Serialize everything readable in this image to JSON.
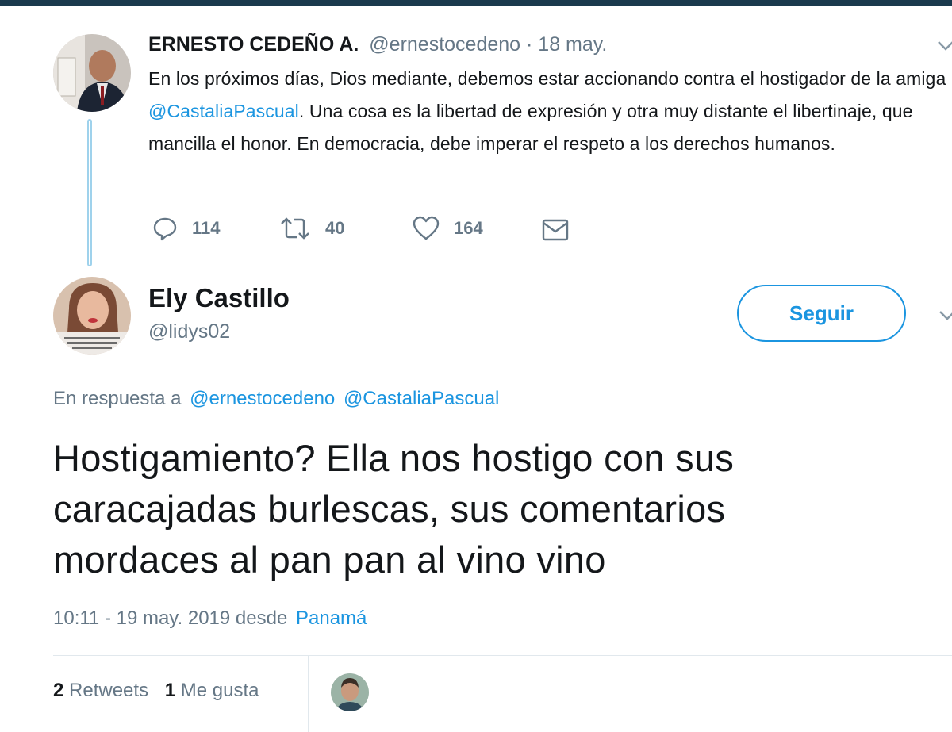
{
  "tweet1": {
    "author_name": "ERNESTO CEDEÑO A.",
    "handle": "@ernestocedeno",
    "date": "· 18 may.",
    "text_before": "En los próximos días, Dios mediante, debemos estar accionando contra el hostigador de la amiga ",
    "mention": "@CastaliaPascual",
    "text_after": ". Una cosa es la libertad de expresión y otra muy distante el libertinaje, que mancilla el honor. En democracia, debe imperar el respeto a los derechos humanos.",
    "replies": "114",
    "retweets": "40",
    "likes": "164"
  },
  "tweet2": {
    "author_name": "Ely Castillo",
    "handle": "@lidys02",
    "follow_label": "Seguir",
    "reply_prefix": "En respuesta a",
    "reply_mention_1": "@ernestocedeno",
    "reply_mention_2": "@CastaliaPascual",
    "text": "Hostigamiento? Ella nos hostigo con sus caracajadas burlescas, sus comentarios mordaces al pan pan al vino vino",
    "timestamp": "10:11 - 19 may. 2019 desde",
    "location": "Panamá",
    "retweet_count": "2",
    "retweet_label": "Retweets",
    "like_count": "1",
    "like_label": "Me gusta"
  },
  "colors": {
    "link": "#1b95e0",
    "muted": "#657786",
    "topbar": "#1a3a4d"
  },
  "icons": [
    "reply-icon",
    "retweet-icon",
    "heart-icon",
    "mail-icon",
    "chevron-down-icon"
  ]
}
